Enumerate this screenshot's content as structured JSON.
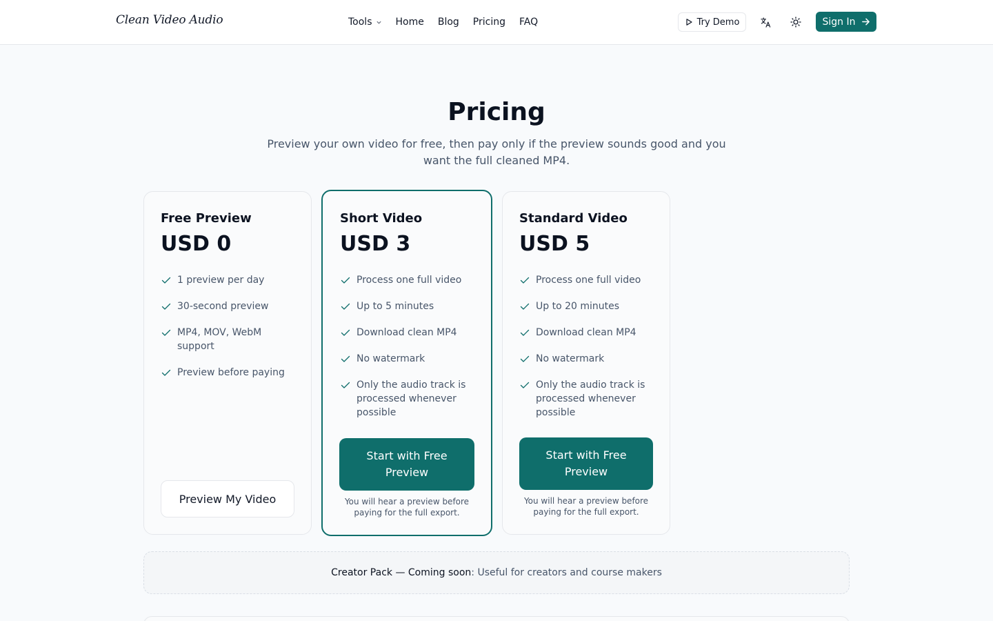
{
  "header": {
    "logo": "Clean Video Audio",
    "nav": [
      {
        "label": "Tools",
        "has_dropdown": true
      },
      {
        "label": "Home"
      },
      {
        "label": "Blog"
      },
      {
        "label": "Pricing"
      },
      {
        "label": "FAQ"
      }
    ],
    "try_demo_label": "Try Demo",
    "language_icon": "translate-icon",
    "theme_icon": "sun-icon",
    "sign_in_label": "Sign In"
  },
  "hero": {
    "title": "Pricing",
    "subtitle": "Preview your own video for free, then pay only if the preview sounds good and you want the full cleaned MP4."
  },
  "plans": [
    {
      "name": "Free Preview",
      "price": "USD 0",
      "features": [
        "1 preview per day",
        "30-second preview",
        "MP4, MOV, WebM support",
        "Preview before paying"
      ],
      "cta": "Preview My Video"
    },
    {
      "name": "Short Video",
      "price": "USD 3",
      "featured": true,
      "features": [
        "Process one full video",
        "Up to 5 minutes",
        "Download clean MP4",
        "No watermark",
        "Only the audio track is processed whenever possible"
      ],
      "cta": "Start with Free Preview",
      "note": "You will hear a preview before paying for the full export."
    },
    {
      "name": "Standard Video",
      "price": "USD 5",
      "features": [
        "Process one full video",
        "Up to 20 minutes",
        "Download clean MP4",
        "No watermark",
        "Only the audio track is processed whenever possible"
      ],
      "cta": "Start with Free Preview",
      "note": "You will hear a preview before paying for the full export."
    }
  ],
  "creator_pack": {
    "title": "Creator Pack — Coming soon",
    "description": "Useful for creators and course makers"
  },
  "colors": {
    "accent": "#0f6e6b",
    "background": "#f8fafc",
    "text": "#0b1220",
    "muted": "#475569"
  }
}
